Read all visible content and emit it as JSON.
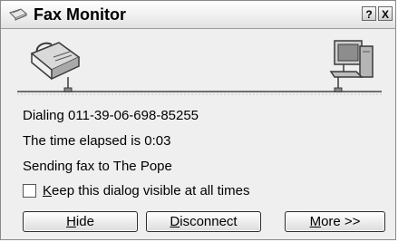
{
  "window": {
    "title": "Fax Monitor",
    "help_button": "?",
    "close_button": "X"
  },
  "status": {
    "dialing": "Dialing 011-39-06-698-85255",
    "elapsed": "The time elapsed is 0:03",
    "sending": "Sending fax to The Pope"
  },
  "checkbox": {
    "label_accel": "K",
    "label_rest": "eep this dialog visible at all times",
    "checked": false
  },
  "buttons": {
    "hide_accel": "H",
    "hide_rest": "ide",
    "disconnect_accel": "D",
    "disconnect_rest": "isconnect",
    "more_accel": "M",
    "more_rest": "ore >>"
  }
}
